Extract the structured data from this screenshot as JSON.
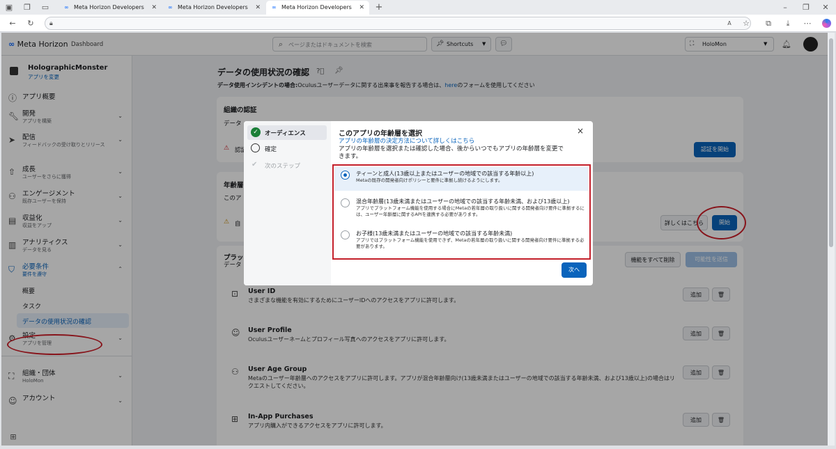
{
  "browser": {
    "tabs": [
      "Meta Horizon Developers",
      "Meta Horizon Developers",
      "Meta Horizon Developers"
    ],
    "new_tab": "+"
  },
  "topnav": {
    "brand": "Meta Horizon",
    "dashboard": "Dashboard",
    "search_placeholder": "ページまたはドキュメントを検索",
    "shortcuts": "Shortcuts",
    "org": "HoloMon"
  },
  "sidebar": {
    "app_name": "HolographicMonster",
    "app_change": "アプリを変更",
    "items": [
      {
        "label": "アプリ概要",
        "sub": ""
      },
      {
        "label": "開発",
        "sub": "アプリを構築"
      },
      {
        "label": "配信",
        "sub": "フィードバックの受け取りとリリース"
      },
      {
        "label": "成長",
        "sub": "ユーザーをさらに獲得"
      },
      {
        "label": "エンゲージメント",
        "sub": "既存ユーザーを保持"
      },
      {
        "label": "収益化",
        "sub": "収益をアップ"
      },
      {
        "label": "アナリティクス",
        "sub": "データを見る"
      },
      {
        "label": "必要条件",
        "sub": "要件を遵守"
      },
      {
        "label": "設定",
        "sub": "アプリを管理"
      },
      {
        "label": "組織・団体",
        "sub": "HoloMon"
      },
      {
        "label": "アカウント",
        "sub": ""
      }
    ],
    "sub_items": [
      "概要",
      "タスク",
      "データの使用状況の確認"
    ]
  },
  "main": {
    "title": "データの使用状況の確認",
    "incident_prefix": "データ使用インシデントの場合:",
    "incident_text": "Oculusユーザーデータに関する出来事を報告する場合は、",
    "incident_link": "here",
    "incident_suffix": "のフォームを使用してください",
    "org_cert_title": "組織の認証",
    "org_cert_desc": "データ",
    "org_cert_warn": "認証",
    "start_cert_button": "認証を開始",
    "age_title": "年齢層",
    "age_desc": "このア",
    "age_warn": "自",
    "learn_more_button": "詳しくはこちら",
    "start_button": "開始",
    "platform_title": "プラット",
    "platform_desc": "データ",
    "delete_all_button": "機能をすべて削除",
    "request_button": "可能性を送信",
    "add_label": "追加",
    "permissions": [
      {
        "name": "User ID",
        "desc": "さまざまな機能を有効にするためにユーザーIDへのアクセスをアプリに許可します。"
      },
      {
        "name": "User Profile",
        "desc": "Oculusユーザーネームとプロフィール写真へのアクセスをアプリに許可します。"
      },
      {
        "name": "User Age Group",
        "desc": "Metaのユーザー年齢層へのアクセスをアプリに許可します。アプリが混合年齢層向け(13歳未満またはユーザーの地域での該当する年齢未満、および13歳以上)の場合はリクエストしてください。"
      },
      {
        "name": "In-App Purchases",
        "desc": "アプリ内購入ができるアクセスをアプリに許可します。"
      }
    ]
  },
  "modal": {
    "steps": [
      "オーディエンス",
      "確定",
      "次のステップ"
    ],
    "title": "このアプリの年齢層を選択",
    "link": "アプリの年齢層の決定方法について詳しくはこちら",
    "desc": "アプリの年齢層を選択または確認した場合、後からいつでもアプリの年齢層を変更できます。",
    "options": [
      {
        "title": "ティーンと成人(13歳以上またはユーザーの地域での該当する年齢以上)",
        "desc": "Metaの既存の開発者向けポリシーと要件に準拠し続けるようにします。",
        "selected": true
      },
      {
        "title": "混合年齢層(13歳未満またはユーザーの地域での該当する年齢未満、および13歳以上)",
        "desc": "アプリでプラットフォーム機能を使用する場合にMetaの若年層の取り扱いに関する開発者向け要件に準拠するには、ユーザー年齢層に関するAPIを連携する必要があります。",
        "selected": false
      },
      {
        "title": "お子様(13歳未満またはユーザーの地域での該当する年齢未満)",
        "desc": "アプリではプラットフォーム機能を使用できず、Metaの若年層の取り扱いに関する開発者向け要件に準拠する必要があります。",
        "selected": false
      }
    ],
    "next_button": "次へ",
    "close": "×"
  },
  "colors": {
    "accent": "#0a64bc",
    "highlight": "#d0202a"
  }
}
